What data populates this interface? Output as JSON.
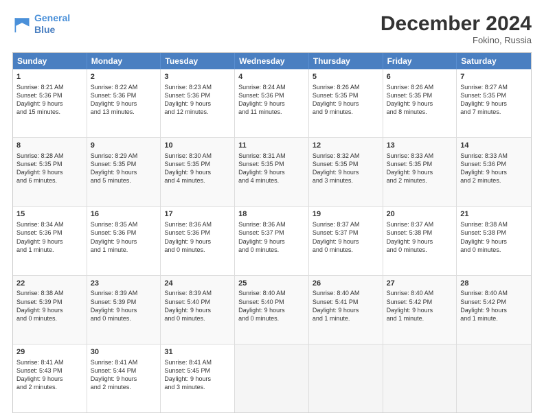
{
  "header": {
    "logo_line1": "General",
    "logo_line2": "Blue",
    "month": "December 2024",
    "location": "Fokino, Russia"
  },
  "weekdays": [
    "Sunday",
    "Monday",
    "Tuesday",
    "Wednesday",
    "Thursday",
    "Friday",
    "Saturday"
  ],
  "rows": [
    [
      {
        "day": "1",
        "lines": [
          "Sunrise: 8:21 AM",
          "Sunset: 5:36 PM",
          "Daylight: 9 hours",
          "and 15 minutes."
        ]
      },
      {
        "day": "2",
        "lines": [
          "Sunrise: 8:22 AM",
          "Sunset: 5:36 PM",
          "Daylight: 9 hours",
          "and 13 minutes."
        ]
      },
      {
        "day": "3",
        "lines": [
          "Sunrise: 8:23 AM",
          "Sunset: 5:36 PM",
          "Daylight: 9 hours",
          "and 12 minutes."
        ]
      },
      {
        "day": "4",
        "lines": [
          "Sunrise: 8:24 AM",
          "Sunset: 5:36 PM",
          "Daylight: 9 hours",
          "and 11 minutes."
        ]
      },
      {
        "day": "5",
        "lines": [
          "Sunrise: 8:26 AM",
          "Sunset: 5:35 PM",
          "Daylight: 9 hours",
          "and 9 minutes."
        ]
      },
      {
        "day": "6",
        "lines": [
          "Sunrise: 8:26 AM",
          "Sunset: 5:35 PM",
          "Daylight: 9 hours",
          "and 8 minutes."
        ]
      },
      {
        "day": "7",
        "lines": [
          "Sunrise: 8:27 AM",
          "Sunset: 5:35 PM",
          "Daylight: 9 hours",
          "and 7 minutes."
        ]
      }
    ],
    [
      {
        "day": "8",
        "lines": [
          "Sunrise: 8:28 AM",
          "Sunset: 5:35 PM",
          "Daylight: 9 hours",
          "and 6 minutes."
        ]
      },
      {
        "day": "9",
        "lines": [
          "Sunrise: 8:29 AM",
          "Sunset: 5:35 PM",
          "Daylight: 9 hours",
          "and 5 minutes."
        ]
      },
      {
        "day": "10",
        "lines": [
          "Sunrise: 8:30 AM",
          "Sunset: 5:35 PM",
          "Daylight: 9 hours",
          "and 4 minutes."
        ]
      },
      {
        "day": "11",
        "lines": [
          "Sunrise: 8:31 AM",
          "Sunset: 5:35 PM",
          "Daylight: 9 hours",
          "and 4 minutes."
        ]
      },
      {
        "day": "12",
        "lines": [
          "Sunrise: 8:32 AM",
          "Sunset: 5:35 PM",
          "Daylight: 9 hours",
          "and 3 minutes."
        ]
      },
      {
        "day": "13",
        "lines": [
          "Sunrise: 8:33 AM",
          "Sunset: 5:35 PM",
          "Daylight: 9 hours",
          "and 2 minutes."
        ]
      },
      {
        "day": "14",
        "lines": [
          "Sunrise: 8:33 AM",
          "Sunset: 5:36 PM",
          "Daylight: 9 hours",
          "and 2 minutes."
        ]
      }
    ],
    [
      {
        "day": "15",
        "lines": [
          "Sunrise: 8:34 AM",
          "Sunset: 5:36 PM",
          "Daylight: 9 hours",
          "and 1 minute."
        ]
      },
      {
        "day": "16",
        "lines": [
          "Sunrise: 8:35 AM",
          "Sunset: 5:36 PM",
          "Daylight: 9 hours",
          "and 1 minute."
        ]
      },
      {
        "day": "17",
        "lines": [
          "Sunrise: 8:36 AM",
          "Sunset: 5:36 PM",
          "Daylight: 9 hours",
          "and 0 minutes."
        ]
      },
      {
        "day": "18",
        "lines": [
          "Sunrise: 8:36 AM",
          "Sunset: 5:37 PM",
          "Daylight: 9 hours",
          "and 0 minutes."
        ]
      },
      {
        "day": "19",
        "lines": [
          "Sunrise: 8:37 AM",
          "Sunset: 5:37 PM",
          "Daylight: 9 hours",
          "and 0 minutes."
        ]
      },
      {
        "day": "20",
        "lines": [
          "Sunrise: 8:37 AM",
          "Sunset: 5:38 PM",
          "Daylight: 9 hours",
          "and 0 minutes."
        ]
      },
      {
        "day": "21",
        "lines": [
          "Sunrise: 8:38 AM",
          "Sunset: 5:38 PM",
          "Daylight: 9 hours",
          "and 0 minutes."
        ]
      }
    ],
    [
      {
        "day": "22",
        "lines": [
          "Sunrise: 8:38 AM",
          "Sunset: 5:39 PM",
          "Daylight: 9 hours",
          "and 0 minutes."
        ]
      },
      {
        "day": "23",
        "lines": [
          "Sunrise: 8:39 AM",
          "Sunset: 5:39 PM",
          "Daylight: 9 hours",
          "and 0 minutes."
        ]
      },
      {
        "day": "24",
        "lines": [
          "Sunrise: 8:39 AM",
          "Sunset: 5:40 PM",
          "Daylight: 9 hours",
          "and 0 minutes."
        ]
      },
      {
        "day": "25",
        "lines": [
          "Sunrise: 8:40 AM",
          "Sunset: 5:40 PM",
          "Daylight: 9 hours",
          "and 0 minutes."
        ]
      },
      {
        "day": "26",
        "lines": [
          "Sunrise: 8:40 AM",
          "Sunset: 5:41 PM",
          "Daylight: 9 hours",
          "and 1 minute."
        ]
      },
      {
        "day": "27",
        "lines": [
          "Sunrise: 8:40 AM",
          "Sunset: 5:42 PM",
          "Daylight: 9 hours",
          "and 1 minute."
        ]
      },
      {
        "day": "28",
        "lines": [
          "Sunrise: 8:40 AM",
          "Sunset: 5:42 PM",
          "Daylight: 9 hours",
          "and 1 minute."
        ]
      }
    ],
    [
      {
        "day": "29",
        "lines": [
          "Sunrise: 8:41 AM",
          "Sunset: 5:43 PM",
          "Daylight: 9 hours",
          "and 2 minutes."
        ]
      },
      {
        "day": "30",
        "lines": [
          "Sunrise: 8:41 AM",
          "Sunset: 5:44 PM",
          "Daylight: 9 hours",
          "and 2 minutes."
        ]
      },
      {
        "day": "31",
        "lines": [
          "Sunrise: 8:41 AM",
          "Sunset: 5:45 PM",
          "Daylight: 9 hours",
          "and 3 minutes."
        ]
      },
      {
        "day": "",
        "lines": []
      },
      {
        "day": "",
        "lines": []
      },
      {
        "day": "",
        "lines": []
      },
      {
        "day": "",
        "lines": []
      }
    ]
  ]
}
